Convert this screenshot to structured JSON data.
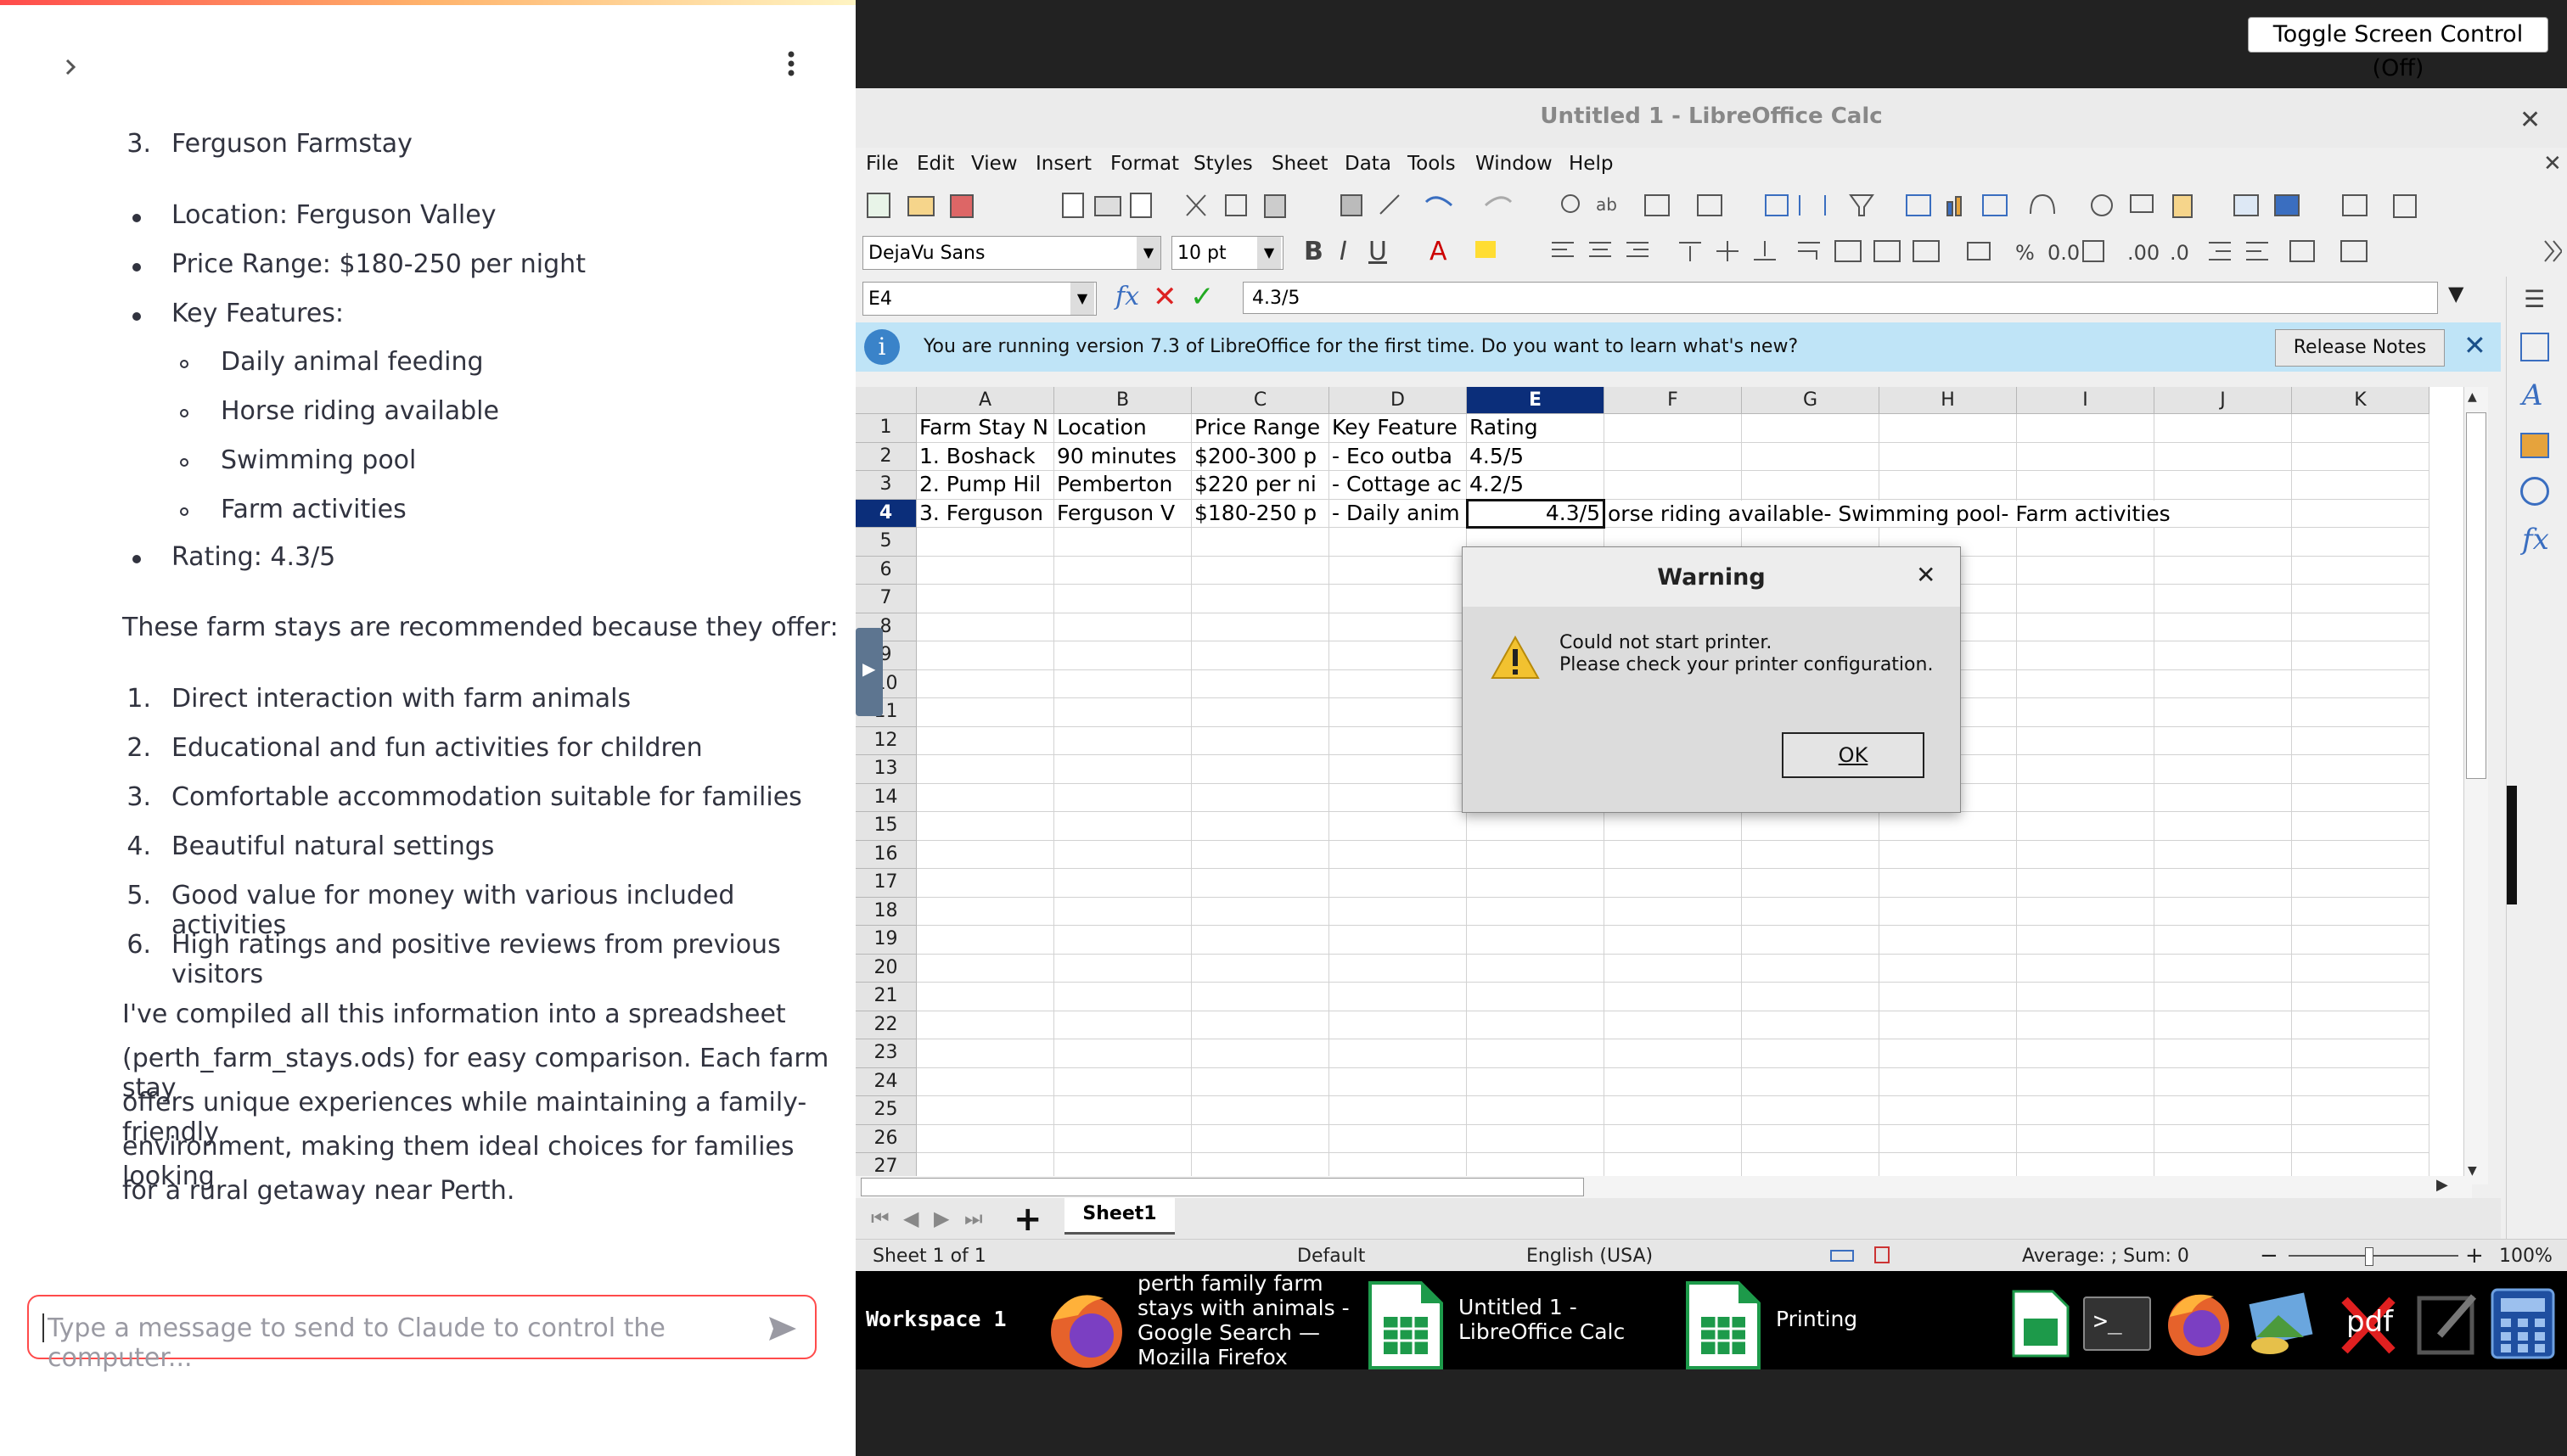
{
  "chat": {
    "list1": [
      {
        "num": "3.",
        "text": "Ferguson Farmstay"
      }
    ],
    "bullets": [
      {
        "text": "Location: Ferguson Valley"
      },
      {
        "text": "Price Range: $180-250 per night"
      },
      {
        "text": "Key Features:"
      },
      {
        "text": "Rating: 4.3/5"
      }
    ],
    "sub_bullets": [
      {
        "text": "Daily animal feeding"
      },
      {
        "text": "Horse riding available"
      },
      {
        "text": "Swimming pool"
      },
      {
        "text": "Farm activities"
      }
    ],
    "intro": "These farm stays are recommended because they offer:",
    "reasons": [
      {
        "num": "1.",
        "text": "Direct interaction with farm animals"
      },
      {
        "num": "2.",
        "text": "Educational and fun activities for children"
      },
      {
        "num": "3.",
        "text": "Comfortable accommodation suitable for families"
      },
      {
        "num": "4.",
        "text": "Beautiful natural settings"
      },
      {
        "num": "5.",
        "text": "Good value for money with various included activities"
      },
      {
        "num": "6.",
        "text": "High ratings and positive reviews from previous visitors"
      }
    ],
    "summary_lines": [
      "I've compiled all this information into a spreadsheet",
      "(perth_farm_stays.ods) for easy comparison. Each farm stay",
      "offers unique experiences while maintaining a family-friendly",
      "environment, making them ideal choices for families looking",
      "for a rural getaway near Perth."
    ],
    "input_placeholder": "Type a message to send to Claude to control the computer..."
  },
  "toggle_button": "Toggle Screen Control (Off)",
  "window_title": "Untitled 1 - LibreOffice Calc",
  "menu": [
    "File",
    "Edit",
    "View",
    "Insert",
    "Format",
    "Styles",
    "Sheet",
    "Data",
    "Tools",
    "Window",
    "Help"
  ],
  "font_name": "DejaVu Sans",
  "font_size": "10 pt",
  "cell_ref": "E4",
  "formula": "4.3/5",
  "infobar": {
    "text": "You are running version 7.3 of LibreOffice for the first time. Do you want to learn what's new?",
    "button": "Release Notes"
  },
  "columns": [
    "A",
    "B",
    "C",
    "D",
    "E",
    "F",
    "G",
    "H",
    "I",
    "J",
    "K"
  ],
  "rows": [
    "1",
    "2",
    "3",
    "4",
    "5",
    "6",
    "7",
    "8",
    "9",
    "10",
    "11",
    "12",
    "13",
    "14",
    "15",
    "16",
    "17",
    "18",
    "19",
    "20",
    "21",
    "22",
    "23",
    "24",
    "25",
    "26",
    "27"
  ],
  "cells": {
    "r1": [
      "Farm Stay N",
      "Location",
      "Price Range",
      "Key Feature",
      "Rating"
    ],
    "r2": [
      "1. Boshack",
      "90 minutes",
      "$200-300 p",
      "- Eco outba",
      "4.5/5"
    ],
    "r3": [
      "2. Pump Hil",
      "Pemberton",
      "$220 per ni",
      "- Cottage ac",
      "4.2/5"
    ],
    "r4": [
      "3. Ferguson",
      "Ferguson V",
      "$180-250 p",
      "- Daily anim",
      "4.3/5",
      "orse riding available- Swimming pool- Farm activities"
    ]
  },
  "dialog": {
    "title": "Warning",
    "line1": "Could not start printer.",
    "line2": "Please check your printer configuration.",
    "ok": "OK"
  },
  "sheet_tab": "Sheet1",
  "status": {
    "sheet": "Sheet 1 of 1",
    "style": "Default",
    "lang": "English (USA)",
    "sum": "Average: ; Sum: 0",
    "zoom": "100%"
  },
  "taskbar": {
    "workspace": "Workspace 1",
    "firefox_lines": [
      "perth family farm",
      "stays with animals -",
      "Google Search —",
      "Mozilla Firefox"
    ],
    "calc_lines": [
      "Untitled 1 -",
      "LibreOffice Calc"
    ],
    "printing": "Printing",
    "pdf": "pdf"
  },
  "colors": {
    "accent": "#ff4b4b",
    "selected_col": "#0b2e7a",
    "infobar": "#bfe4f7",
    "taskbar": "#000000"
  }
}
